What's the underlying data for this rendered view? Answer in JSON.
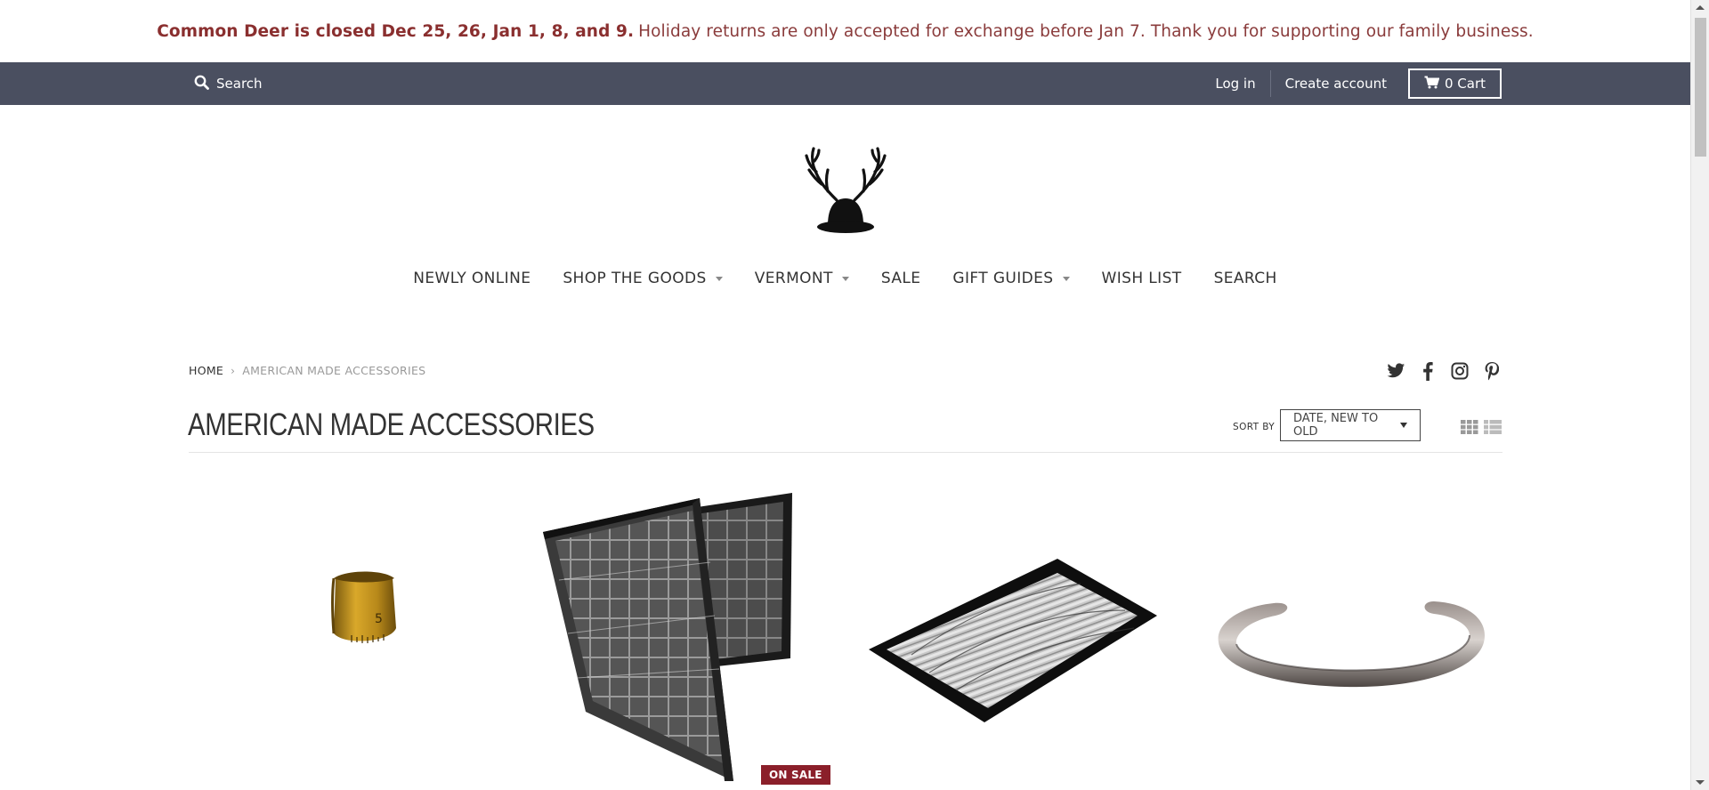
{
  "announcement": {
    "bold": "Common Deer is closed Dec 25, 26, Jan 1, 8, and 9.",
    "rest": "Holiday returns are only accepted for exchange before Jan 7. Thank you for supporting our family business."
  },
  "topbar": {
    "search_label": "Search",
    "login_label": "Log in",
    "create_account_label": "Create account",
    "cart_label": "0 Cart"
  },
  "nav": {
    "items": [
      {
        "label": "NEWLY ONLINE",
        "dropdown": false
      },
      {
        "label": "SHOP THE GOODS",
        "dropdown": true
      },
      {
        "label": "VERMONT",
        "dropdown": true
      },
      {
        "label": "SALE",
        "dropdown": false
      },
      {
        "label": "GIFT GUIDES",
        "dropdown": true
      },
      {
        "label": "WISH LIST",
        "dropdown": false
      },
      {
        "label": "SEARCH",
        "dropdown": false
      }
    ]
  },
  "breadcrumb": {
    "home": "HOME",
    "separator": "›",
    "current": "AMERICAN MADE ACCESSORIES"
  },
  "social": [
    "twitter-icon",
    "facebook-icon",
    "instagram-icon",
    "pinterest-icon"
  ],
  "collection": {
    "title": "AMERICAN MADE ACCESSORIES",
    "sort_label": "SORT BY",
    "sort_value": "DATE, NEW TO OLD"
  },
  "products": [
    {
      "image": "brass-ruler-ring",
      "badge": ""
    },
    {
      "image": "sailcloth-bifold-wallet",
      "badge": "ON SALE"
    },
    {
      "image": "flat-sailcloth-wallet",
      "badge": ""
    },
    {
      "image": "silver-cuff-bracelet",
      "badge": ""
    }
  ],
  "colors": {
    "announcement_text": "#8a2f2f",
    "topbar_bg": "#4a4f60",
    "sale_badge": "#8b1f2a"
  }
}
